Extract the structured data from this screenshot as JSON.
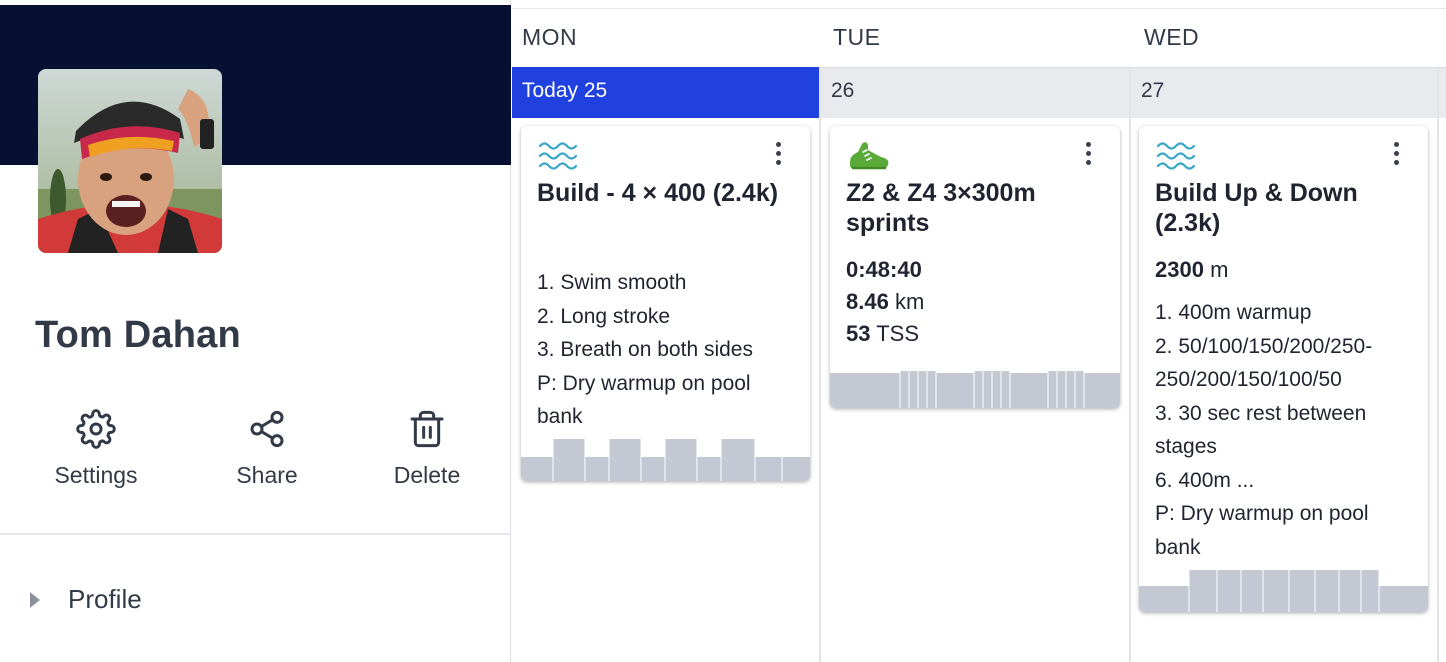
{
  "profile": {
    "name": "Tom Dahan",
    "actions": [
      {
        "label": "Settings",
        "icon": "gear-icon"
      },
      {
        "label": "Share",
        "icon": "share-icon"
      },
      {
        "label": "Delete",
        "icon": "trash-icon"
      }
    ],
    "section": "Profile"
  },
  "calendar": {
    "days": [
      {
        "name": "MON",
        "date": "Today 25",
        "is_today": true
      },
      {
        "name": "TUE",
        "date": "26",
        "is_today": false
      },
      {
        "name": "WED",
        "date": "27",
        "is_today": false
      }
    ],
    "workouts": [
      {
        "sport_icon": "swim-icon",
        "title": "Build - 4 × 400 (2.4k)",
        "description": [
          "1. Swim smooth",
          "2. Long stroke",
          "3. Breath on both sides",
          "P: Dry warmup on pool",
          "bank"
        ]
      },
      {
        "sport_icon": "run-shoe-icon",
        "title": "Z2 & Z4 3×300m sprints",
        "metrics": [
          {
            "value": "0:48:40",
            "unit": ""
          },
          {
            "value": "8.46",
            "unit": "km"
          },
          {
            "value": "53",
            "unit": "TSS"
          }
        ]
      },
      {
        "sport_icon": "swim-icon",
        "title": "Build Up & Down (2.3k)",
        "metrics": [
          {
            "value": "2300",
            "unit": "m"
          }
        ],
        "description": [
          "1. 400m warmup",
          "2. 50/100/150/200/250-",
          "250/200/150/100/50",
          "3. 30 sec rest between",
          "stages",
          "6. 400m ...",
          "P: Dry warmup on pool",
          "bank"
        ]
      }
    ]
  },
  "colors": {
    "banner": "#051033",
    "today": "#2140e0",
    "swim_icon": "#3aa6c7",
    "run_icon": "#5aaa3a",
    "graph": "#c3c8d3"
  }
}
